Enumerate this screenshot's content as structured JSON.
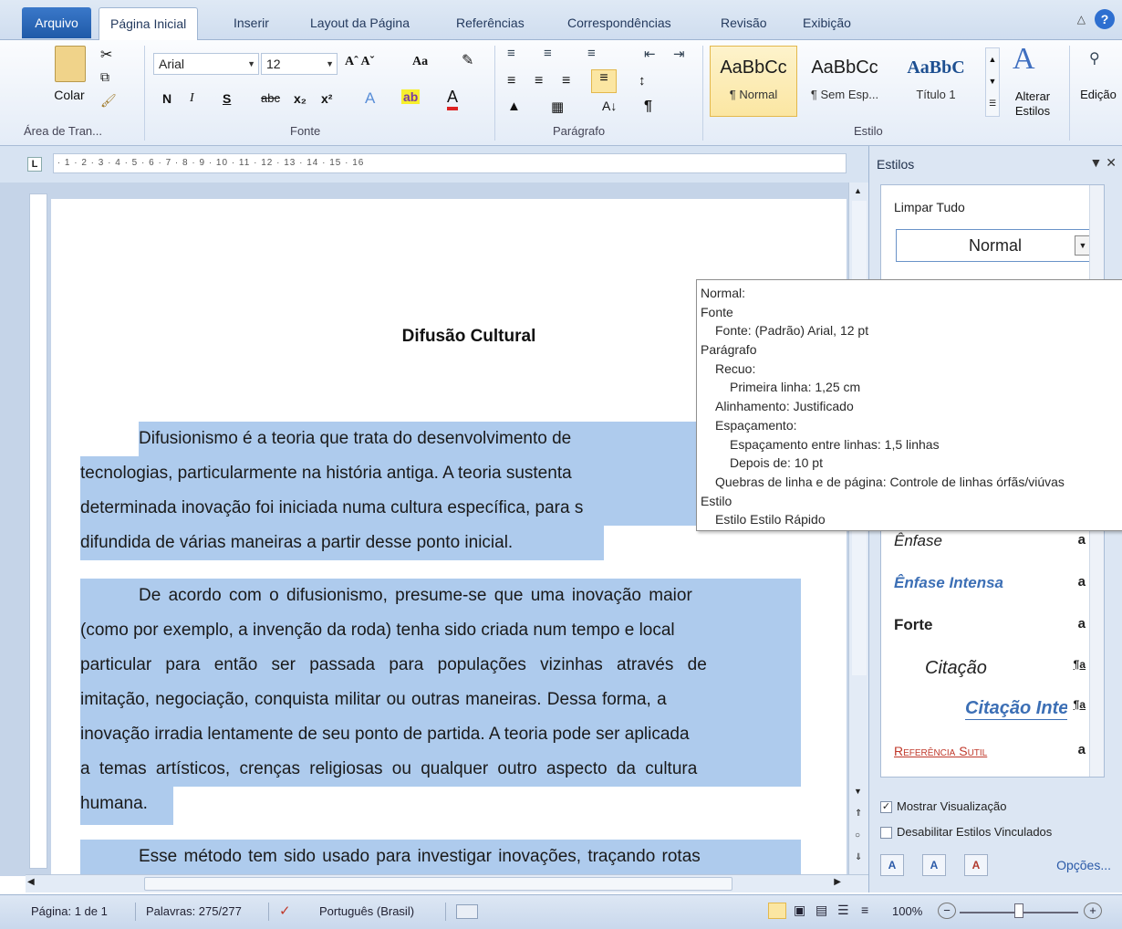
{
  "tabs": [
    "Arquivo",
    "Página Inicial",
    "Inserir",
    "Layout da Página",
    "Referências",
    "Correspondências",
    "Revisão",
    "Exibição"
  ],
  "ribbon": {
    "clipboard": {
      "paste_label": "Colar",
      "group_label": "Área de Tran..."
    },
    "font": {
      "family": "Arial",
      "size": "12",
      "group_label": "Fonte",
      "bold": "N",
      "italic": "I",
      "underline": "S",
      "strike": "abc",
      "sub": "x₂",
      "sup": "x²",
      "case": "Aa"
    },
    "paragraph": {
      "group_label": "Parágrafo"
    },
    "styles": {
      "group_label": "Estilo",
      "items": [
        {
          "preview": "AaBbCc",
          "name": "¶ Normal"
        },
        {
          "preview": "AaBbCc",
          "name": "¶ Sem Esp..."
        },
        {
          "preview": "AaBbC",
          "name": "Título 1"
        }
      ],
      "change_label": "Alterar Estilos",
      "edit_label": "Edição"
    }
  },
  "document": {
    "title": "Difusão Cultural",
    "paragraphs": [
      [
        "Difusionismo é a teoria que trata do desenvolvimento de",
        "tecnologias, particularmente na história antiga. A teoria sustenta",
        "determinada inovação foi iniciada numa cultura específica, para s",
        "difundida de várias maneiras a partir desse ponto inicial."
      ],
      [
        "De acordo com o difusionismo, presume-se que uma inovação maior",
        "(como por exemplo, a invenção da roda) tenha sido criada num tempo e local",
        "particular para então ser passada para populações vizinhas através de",
        "imitação, negociação, conquista militar ou outras maneiras. Dessa forma, a",
        "inovação irradia lentamente de seu ponto de partida. A teoria pode ser aplicada",
        "a temas artísticos, crenças religiosas ou qualquer outro aspecto da cultura",
        "humana."
      ],
      [
        "Esse método tem sido usado para investigar inovações, traçando rotas"
      ]
    ]
  },
  "styles_pane": {
    "title": "Estilos",
    "clear_all": "Limpar Tudo",
    "current": "Normal",
    "items": [
      {
        "label": "Ênfase",
        "mark": "a"
      },
      {
        "label": "Ênfase Intensa",
        "mark": "a"
      },
      {
        "label": "Forte",
        "mark": "a"
      },
      {
        "label": "Citação",
        "mark": "¶a"
      },
      {
        "label": "Citação Inte",
        "mark": "¶a"
      },
      {
        "label": "Referência Sutil",
        "mark": "a"
      }
    ],
    "show_preview": "Mostrar Visualização",
    "disable_linked": "Desabilitar Estilos Vinculados",
    "options": "Opções..."
  },
  "tooltip": {
    "lines": [
      {
        "text": "Normal:",
        "indent": 0
      },
      {
        "text": "Fonte",
        "indent": 0
      },
      {
        "text": "Fonte: (Padrão) Arial, 12 pt",
        "indent": 1
      },
      {
        "text": "Parágrafo",
        "indent": 0
      },
      {
        "text": "Recuo:",
        "indent": 1
      },
      {
        "text": "Primeira linha: 1,25 cm",
        "indent": 2
      },
      {
        "text": "Alinhamento: Justificado",
        "indent": 1
      },
      {
        "text": "Espaçamento:",
        "indent": 1
      },
      {
        "text": "Espaçamento entre linhas: 1,5 linhas",
        "indent": 2
      },
      {
        "text": "Depois de: 10 pt",
        "indent": 2
      },
      {
        "text": "Quebras de linha e de página: Controle de linhas órfãs/viúvas",
        "indent": 1
      },
      {
        "text": "Estilo",
        "indent": 0
      },
      {
        "text": "Estilo Estilo Rápido",
        "indent": 1
      }
    ]
  },
  "statusbar": {
    "page": "Página: 1 de 1",
    "words": "Palavras: 275/277",
    "language": "Português (Brasil)",
    "zoom": "100%"
  },
  "colors": {
    "selection": "#aecbed",
    "ribbon_accent": "#1f5aa8"
  }
}
